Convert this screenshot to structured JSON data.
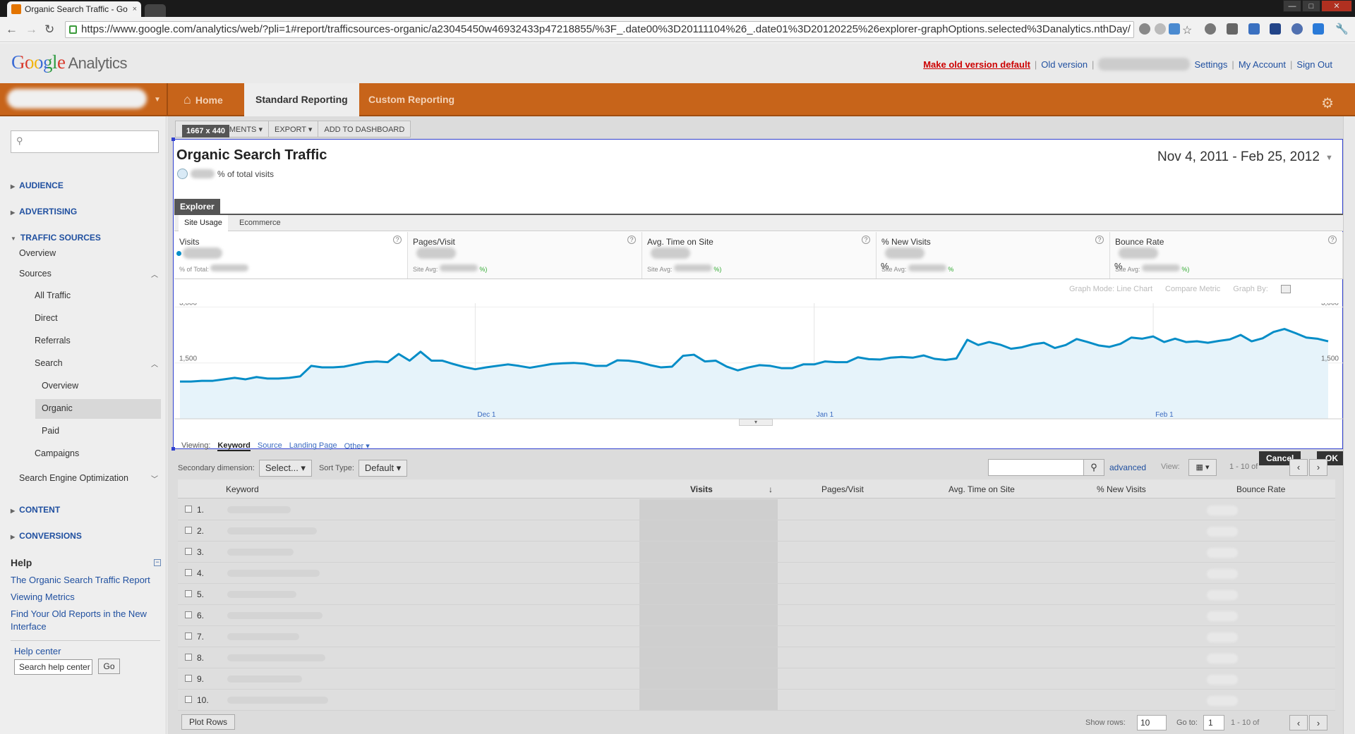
{
  "browser": {
    "tab_title": "Organic Search Traffic - Go",
    "tab_close": "×",
    "url": "https://www.google.com/analytics/web/?pli=1#report/trafficsources-organic/a23045450w46932433p47218855/%3F_.date00%3D20111104%26_.date01%3D20120225%26explorer-graphOptions.selected%3Danalytics.nthDay/",
    "nav": {
      "back": "←",
      "forward": "→",
      "reload": "↻",
      "star": "☆",
      "wrench": "🔧"
    },
    "win": {
      "min": "—",
      "max": "□",
      "close": "✕"
    }
  },
  "header": {
    "logo_google": "Google",
    "logo_analytics": "Analytics",
    "make_old_default": "Make old version default",
    "old_version": "Old version",
    "settings": "Settings",
    "my_account": "My Account",
    "sign_out": "Sign Out",
    "sep": "|"
  },
  "topnav": {
    "home": "Home",
    "standard_reporting": "Standard Reporting",
    "custom_reporting": "Custom Reporting",
    "home_icon": "⌂",
    "gear": "⚙"
  },
  "sidebar": {
    "search_icon": "⚲",
    "audience": "AUDIENCE",
    "advertising": "ADVERTISING",
    "traffic_sources": "TRAFFIC SOURCES",
    "overview": "Overview",
    "sources": "Sources",
    "all_traffic": "All Traffic",
    "direct": "Direct",
    "referrals": "Referrals",
    "search": "Search",
    "search_overview": "Overview",
    "organic": "Organic",
    "paid": "Paid",
    "campaigns": "Campaigns",
    "seo": "Search Engine Optimization",
    "content": "CONTENT",
    "conversions": "CONVERSIONS",
    "arrow_right": "▶",
    "arrow_down": "▼",
    "collapse_up": "︿",
    "collapse_down": "﹀"
  },
  "help": {
    "title": "Help",
    "minus": "−",
    "links": [
      "The Organic Search Traffic Report",
      "Viewing Metrics",
      "Find Your Old Reports in the New Interface"
    ],
    "help_center": "Help center",
    "search_placeholder": "Search help center",
    "go": "Go"
  },
  "toolbar": {
    "dim_tip": "1667 x 440",
    "segments": "EGMENTS ▾",
    "export": "EXPORT ▾",
    "add_dashboard": "ADD TO DASHBOARD"
  },
  "report": {
    "title": "Organic Search Traffic",
    "pct_suffix": "% of total visits",
    "date_range": "Nov 4, 2011 - Feb 25, 2012",
    "date_arrow": "▼",
    "explorer": "Explorer",
    "site_usage": "Site Usage",
    "ecommerce": "Ecommerce"
  },
  "metrics": [
    {
      "name": "Visits",
      "avg_label": "% of Total:",
      "suffix": ""
    },
    {
      "name": "Pages/Visit",
      "avg_label": "Site Avg:",
      "suffix": "%)"
    },
    {
      "name": "Avg. Time on Site",
      "avg_label": "Site Avg:",
      "suffix": "%)"
    },
    {
      "name": "% New Visits",
      "avg_label": "Site Avg:",
      "suffix": "%"
    },
    {
      "name": "Bounce Rate",
      "avg_label": "Site Avg:",
      "suffix": "%)"
    }
  ],
  "metric_extra": {
    "pct": "%",
    "q": "?"
  },
  "graph_controls": {
    "mode": "Graph Mode:",
    "line_chart": "Line Chart",
    "compare": "Compare Metric",
    "graph_by": "Graph By:"
  },
  "chart_data": {
    "type": "area",
    "series": [
      {
        "name": "Visits",
        "values": [
          1000,
          1000,
          1020,
          1020,
          1060,
          1100,
          1060,
          1120,
          1080,
          1080,
          1100,
          1140,
          1420,
          1380,
          1380,
          1400,
          1460,
          1520,
          1540,
          1520,
          1740,
          1560,
          1800,
          1560,
          1560,
          1470,
          1390,
          1330,
          1380,
          1420,
          1460,
          1420,
          1370,
          1420,
          1470,
          1490,
          1500,
          1480,
          1420,
          1420,
          1570,
          1560,
          1520,
          1440,
          1380,
          1400,
          1690,
          1720,
          1540,
          1560,
          1400,
          1300,
          1380,
          1440,
          1420,
          1360,
          1360,
          1460,
          1460,
          1540,
          1520,
          1520,
          1650,
          1600,
          1590,
          1640,
          1660,
          1640,
          1700,
          1610,
          1580,
          1620,
          2120,
          1980,
          2060,
          1990,
          1880,
          1920,
          2000,
          2040,
          1900,
          1980,
          2140,
          2060,
          1970,
          1930,
          2010,
          2180,
          2150,
          2210,
          2060,
          2150,
          2060,
          2080,
          2040,
          2090,
          2130,
          2250,
          2080,
          2160,
          2330,
          2410,
          2300,
          2180,
          2150,
          2080
        ],
        "color": "#058dc7"
      }
    ],
    "x_labels": [
      "Dec 1",
      "Jan 1",
      "Feb 1"
    ],
    "ytick_left": [
      "3,000",
      "1,500"
    ],
    "ytick_right": [
      "3,000",
      "1,500"
    ],
    "ylim": [
      0,
      3000
    ],
    "grid": true
  },
  "viewing": {
    "label": "Viewing:",
    "keyword": "Keyword",
    "source": "Source",
    "landing": "Landing Page",
    "other": "Other ▾"
  },
  "buttons": {
    "cancel": "Cancel",
    "ok": "OK"
  },
  "table_controls": {
    "secondary": "Secondary dimension:",
    "select": "Select... ▾",
    "sort_type": "Sort Type:",
    "default": "Default ▾",
    "search_icon": "⚲",
    "advanced": "advanced",
    "view": "View:",
    "view_icon": "▦ ▾",
    "range": "1 - 10 of",
    "prev": "‹",
    "next": "›"
  },
  "table": {
    "headers": [
      "Keyword",
      "Visits",
      "Pages/Visit",
      "Avg. Time on Site",
      "% New Visits",
      "Bounce Rate"
    ],
    "sort_arrow": "↓",
    "rows": [
      "1.",
      "2.",
      "3.",
      "4.",
      "5.",
      "6.",
      "7.",
      "8.",
      "9.",
      "10."
    ]
  },
  "footer": {
    "plot_rows": "Plot Rows",
    "show_rows": "Show rows:",
    "rows": "10",
    "goto": "Go to:",
    "goto_val": "1",
    "range": "1 - 10 of"
  }
}
